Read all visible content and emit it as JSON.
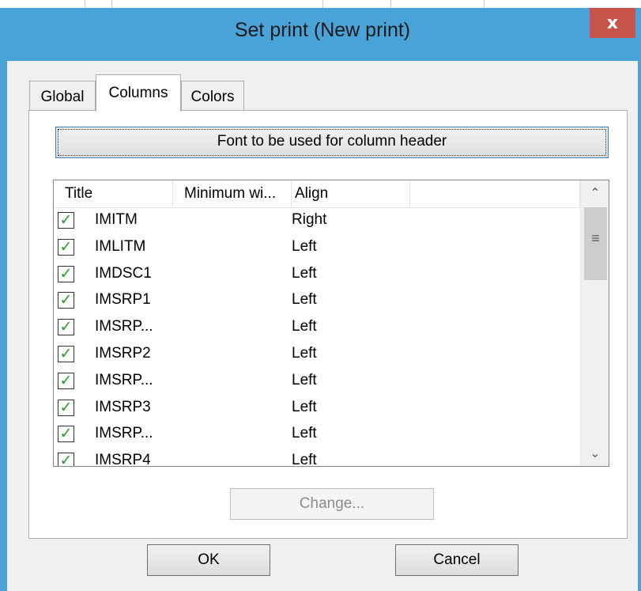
{
  "window": {
    "title": "Set print (New print)",
    "close_glyph": "x"
  },
  "tabs": [
    {
      "label": "Global"
    },
    {
      "label": "Columns"
    },
    {
      "label": "Colors"
    }
  ],
  "font_button": {
    "label": "Font to be used for column header"
  },
  "list": {
    "headers": [
      "Title",
      "Minimum wi...",
      "Align"
    ],
    "rows": [
      {
        "title": "IMITM",
        "align": "Right"
      },
      {
        "title": "IMLITM",
        "align": "Left"
      },
      {
        "title": "IMDSC1",
        "align": "Left"
      },
      {
        "title": "IMSRP1",
        "align": "Left"
      },
      {
        "title": "IMSRP...",
        "align": "Left"
      },
      {
        "title": "IMSRP2",
        "align": "Left"
      },
      {
        "title": "IMSRP...",
        "align": "Left"
      },
      {
        "title": "IMSRP3",
        "align": "Left"
      },
      {
        "title": "IMSRP...",
        "align": "Left"
      },
      {
        "title": "IMSRP4",
        "align": "Left"
      }
    ]
  },
  "change_button": {
    "label": "Change..."
  },
  "buttons": {
    "ok": "OK",
    "cancel": "Cancel"
  },
  "icons": {
    "check": "✓",
    "scroll_up": "⌃",
    "scroll_down": "⌄",
    "grip": "≡"
  },
  "colors": {
    "title_bar": "#4aa3d8",
    "close": "#c7534b",
    "check": "#21a121"
  }
}
